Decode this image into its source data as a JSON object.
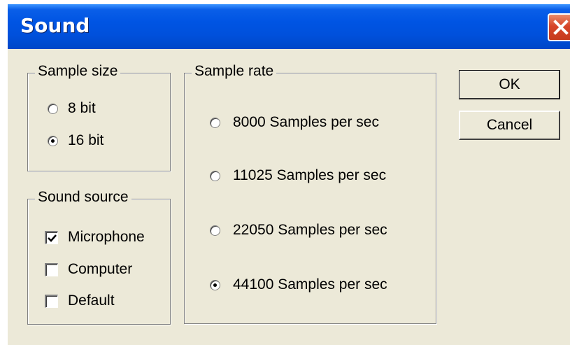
{
  "window": {
    "title": "Sound"
  },
  "sample_size": {
    "legend": "Sample size",
    "options": [
      {
        "label": "8  bit",
        "selected": false
      },
      {
        "label": "16 bit",
        "selected": true
      }
    ]
  },
  "sound_source": {
    "legend": "Sound source",
    "options": [
      {
        "label": "Microphone",
        "checked": true
      },
      {
        "label": "Computer",
        "checked": false
      },
      {
        "label": "Default",
        "checked": false
      }
    ]
  },
  "sample_rate": {
    "legend": "Sample rate",
    "options": [
      {
        "label": "8000 Samples per sec",
        "selected": false
      },
      {
        "label": "11025 Samples per sec",
        "selected": false
      },
      {
        "label": "22050 Samples per sec",
        "selected": false
      },
      {
        "label": "44100 Samples per sec",
        "selected": true
      }
    ]
  },
  "buttons": {
    "ok": "OK",
    "cancel": "Cancel"
  }
}
